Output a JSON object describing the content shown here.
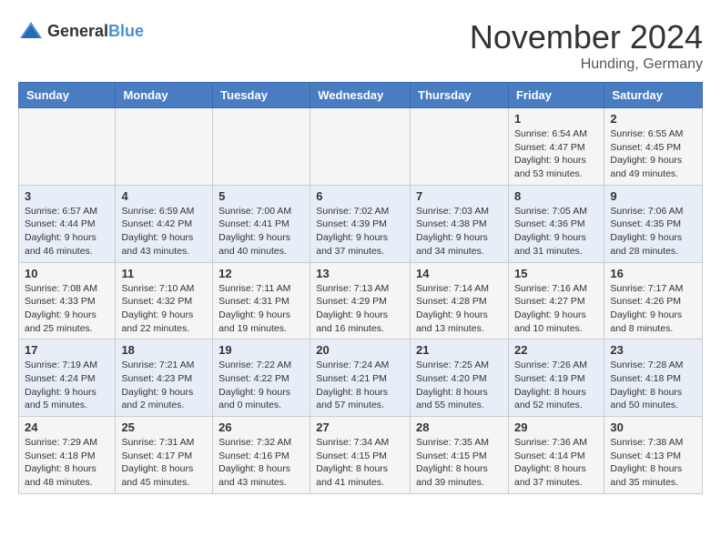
{
  "logo": {
    "general": "General",
    "blue": "Blue"
  },
  "header": {
    "month": "November 2024",
    "location": "Hunding, Germany"
  },
  "weekdays": [
    "Sunday",
    "Monday",
    "Tuesday",
    "Wednesday",
    "Thursday",
    "Friday",
    "Saturday"
  ],
  "rows": [
    [
      {
        "day": "",
        "sunrise": "",
        "sunset": "",
        "daylight": ""
      },
      {
        "day": "",
        "sunrise": "",
        "sunset": "",
        "daylight": ""
      },
      {
        "day": "",
        "sunrise": "",
        "sunset": "",
        "daylight": ""
      },
      {
        "day": "",
        "sunrise": "",
        "sunset": "",
        "daylight": ""
      },
      {
        "day": "",
        "sunrise": "",
        "sunset": "",
        "daylight": ""
      },
      {
        "day": "1",
        "sunrise": "Sunrise: 6:54 AM",
        "sunset": "Sunset: 4:47 PM",
        "daylight": "Daylight: 9 hours and 53 minutes."
      },
      {
        "day": "2",
        "sunrise": "Sunrise: 6:55 AM",
        "sunset": "Sunset: 4:45 PM",
        "daylight": "Daylight: 9 hours and 49 minutes."
      }
    ],
    [
      {
        "day": "3",
        "sunrise": "Sunrise: 6:57 AM",
        "sunset": "Sunset: 4:44 PM",
        "daylight": "Daylight: 9 hours and 46 minutes."
      },
      {
        "day": "4",
        "sunrise": "Sunrise: 6:59 AM",
        "sunset": "Sunset: 4:42 PM",
        "daylight": "Daylight: 9 hours and 43 minutes."
      },
      {
        "day": "5",
        "sunrise": "Sunrise: 7:00 AM",
        "sunset": "Sunset: 4:41 PM",
        "daylight": "Daylight: 9 hours and 40 minutes."
      },
      {
        "day": "6",
        "sunrise": "Sunrise: 7:02 AM",
        "sunset": "Sunset: 4:39 PM",
        "daylight": "Daylight: 9 hours and 37 minutes."
      },
      {
        "day": "7",
        "sunrise": "Sunrise: 7:03 AM",
        "sunset": "Sunset: 4:38 PM",
        "daylight": "Daylight: 9 hours and 34 minutes."
      },
      {
        "day": "8",
        "sunrise": "Sunrise: 7:05 AM",
        "sunset": "Sunset: 4:36 PM",
        "daylight": "Daylight: 9 hours and 31 minutes."
      },
      {
        "day": "9",
        "sunrise": "Sunrise: 7:06 AM",
        "sunset": "Sunset: 4:35 PM",
        "daylight": "Daylight: 9 hours and 28 minutes."
      }
    ],
    [
      {
        "day": "10",
        "sunrise": "Sunrise: 7:08 AM",
        "sunset": "Sunset: 4:33 PM",
        "daylight": "Daylight: 9 hours and 25 minutes."
      },
      {
        "day": "11",
        "sunrise": "Sunrise: 7:10 AM",
        "sunset": "Sunset: 4:32 PM",
        "daylight": "Daylight: 9 hours and 22 minutes."
      },
      {
        "day": "12",
        "sunrise": "Sunrise: 7:11 AM",
        "sunset": "Sunset: 4:31 PM",
        "daylight": "Daylight: 9 hours and 19 minutes."
      },
      {
        "day": "13",
        "sunrise": "Sunrise: 7:13 AM",
        "sunset": "Sunset: 4:29 PM",
        "daylight": "Daylight: 9 hours and 16 minutes."
      },
      {
        "day": "14",
        "sunrise": "Sunrise: 7:14 AM",
        "sunset": "Sunset: 4:28 PM",
        "daylight": "Daylight: 9 hours and 13 minutes."
      },
      {
        "day": "15",
        "sunrise": "Sunrise: 7:16 AM",
        "sunset": "Sunset: 4:27 PM",
        "daylight": "Daylight: 9 hours and 10 minutes."
      },
      {
        "day": "16",
        "sunrise": "Sunrise: 7:17 AM",
        "sunset": "Sunset: 4:26 PM",
        "daylight": "Daylight: 9 hours and 8 minutes."
      }
    ],
    [
      {
        "day": "17",
        "sunrise": "Sunrise: 7:19 AM",
        "sunset": "Sunset: 4:24 PM",
        "daylight": "Daylight: 9 hours and 5 minutes."
      },
      {
        "day": "18",
        "sunrise": "Sunrise: 7:21 AM",
        "sunset": "Sunset: 4:23 PM",
        "daylight": "Daylight: 9 hours and 2 minutes."
      },
      {
        "day": "19",
        "sunrise": "Sunrise: 7:22 AM",
        "sunset": "Sunset: 4:22 PM",
        "daylight": "Daylight: 9 hours and 0 minutes."
      },
      {
        "day": "20",
        "sunrise": "Sunrise: 7:24 AM",
        "sunset": "Sunset: 4:21 PM",
        "daylight": "Daylight: 8 hours and 57 minutes."
      },
      {
        "day": "21",
        "sunrise": "Sunrise: 7:25 AM",
        "sunset": "Sunset: 4:20 PM",
        "daylight": "Daylight: 8 hours and 55 minutes."
      },
      {
        "day": "22",
        "sunrise": "Sunrise: 7:26 AM",
        "sunset": "Sunset: 4:19 PM",
        "daylight": "Daylight: 8 hours and 52 minutes."
      },
      {
        "day": "23",
        "sunrise": "Sunrise: 7:28 AM",
        "sunset": "Sunset: 4:18 PM",
        "daylight": "Daylight: 8 hours and 50 minutes."
      }
    ],
    [
      {
        "day": "24",
        "sunrise": "Sunrise: 7:29 AM",
        "sunset": "Sunset: 4:18 PM",
        "daylight": "Daylight: 8 hours and 48 minutes."
      },
      {
        "day": "25",
        "sunrise": "Sunrise: 7:31 AM",
        "sunset": "Sunset: 4:17 PM",
        "daylight": "Daylight: 8 hours and 45 minutes."
      },
      {
        "day": "26",
        "sunrise": "Sunrise: 7:32 AM",
        "sunset": "Sunset: 4:16 PM",
        "daylight": "Daylight: 8 hours and 43 minutes."
      },
      {
        "day": "27",
        "sunrise": "Sunrise: 7:34 AM",
        "sunset": "Sunset: 4:15 PM",
        "daylight": "Daylight: 8 hours and 41 minutes."
      },
      {
        "day": "28",
        "sunrise": "Sunrise: 7:35 AM",
        "sunset": "Sunset: 4:15 PM",
        "daylight": "Daylight: 8 hours and 39 minutes."
      },
      {
        "day": "29",
        "sunrise": "Sunrise: 7:36 AM",
        "sunset": "Sunset: 4:14 PM",
        "daylight": "Daylight: 8 hours and 37 minutes."
      },
      {
        "day": "30",
        "sunrise": "Sunrise: 7:38 AM",
        "sunset": "Sunset: 4:13 PM",
        "daylight": "Daylight: 8 hours and 35 minutes."
      }
    ]
  ]
}
